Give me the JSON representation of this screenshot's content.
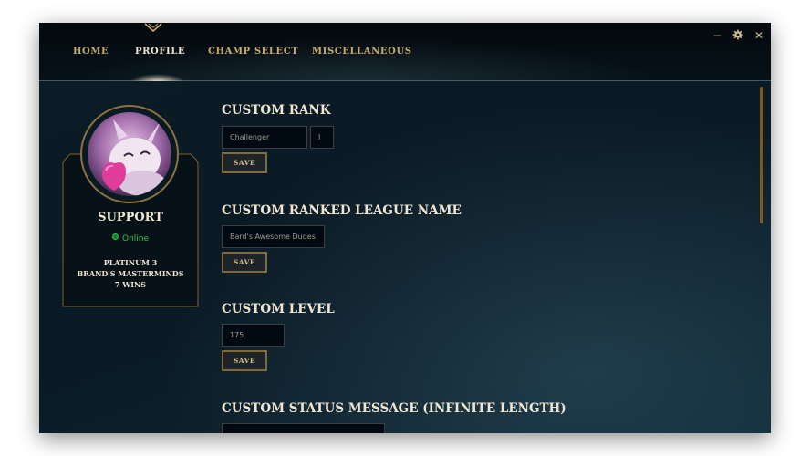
{
  "nav": {
    "tabs": [
      {
        "label": "HOME",
        "active": false
      },
      {
        "label": "PROFILE",
        "active": true
      },
      {
        "label": "CHAMP SELECT",
        "active": false
      },
      {
        "label": "MISCELLANEOUS",
        "active": false
      }
    ]
  },
  "window_controls": {
    "minimize": "−",
    "settings_icon": "gear-icon",
    "close": "✕"
  },
  "profile": {
    "summoner_name": "SUPPORT",
    "status": "Online",
    "rank": "PLATINUM 3",
    "league": "BRAND'S MASTERMINDS",
    "wins": "7 WINS"
  },
  "sections": {
    "custom_rank": {
      "title": "CUSTOM RANK",
      "tier_value": "Challenger",
      "division_value": "I",
      "save_label": "SAVE"
    },
    "custom_league_name": {
      "title": "CUSTOM RANKED LEAGUE NAME",
      "value": "Bard's Awesome Dudes",
      "save_label": "SAVE"
    },
    "custom_level": {
      "title": "CUSTOM LEVEL",
      "value": "175",
      "save_label": "SAVE"
    },
    "custom_status": {
      "title": "CUSTOM STATUS MESSAGE (INFINITE LENGTH)"
    }
  },
  "colors": {
    "gold": "#c8aa6e",
    "light_text": "#f0e6d2",
    "online_green": "#2ec44a",
    "button_border": "#7f6a3b"
  }
}
